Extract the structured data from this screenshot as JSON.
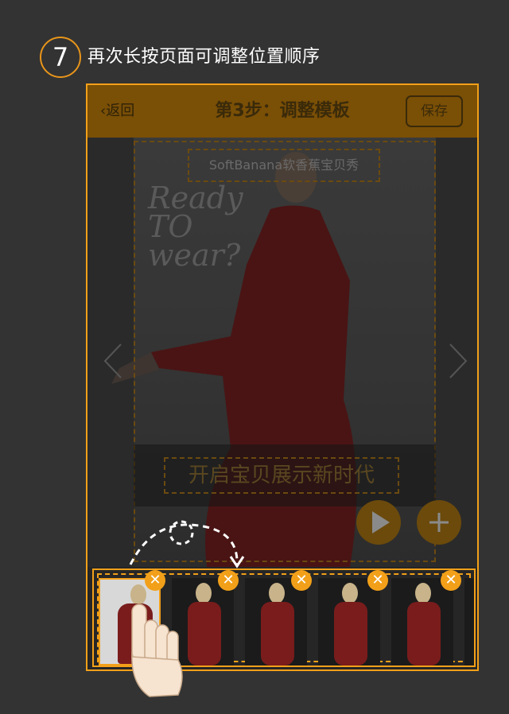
{
  "step": {
    "number": "7",
    "instruction": "再次长按页面可调整位置顺序"
  },
  "topbar": {
    "back_label": "返回",
    "title": "第3步：调整模板",
    "save_label": "保存"
  },
  "canvas": {
    "poster_text": "Ready TO wear?",
    "top_text": "SoftBanana软香蕉宝贝秀",
    "bottom_text": "开启宝贝展示新时代"
  },
  "icons": {
    "back": "chevron-left-icon",
    "prev": "chevron-left-icon",
    "next": "chevron-right-icon",
    "play": "play-icon",
    "add": "plus-icon",
    "remove": "close-icon",
    "hand": "hand-pointer-icon"
  },
  "colors": {
    "accent": "#f2a019",
    "topbar": "#7a4f06",
    "background": "#333333"
  },
  "thumbnails": [
    {
      "active": true
    },
    {
      "active": false
    },
    {
      "active": false
    },
    {
      "active": false
    },
    {
      "active": false
    },
    {
      "active": false
    }
  ]
}
